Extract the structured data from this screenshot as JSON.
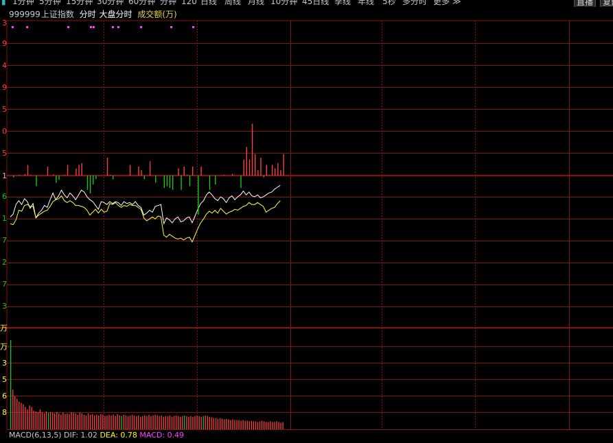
{
  "topbar": {
    "items": [
      "1分钟",
      "5分钟",
      "15分钟",
      "30分钟",
      "60分钟",
      "分钟",
      "120",
      "日线",
      "周线",
      "月线",
      "10分钟",
      "45日线",
      "季线",
      "年线",
      "5秒",
      "多分时",
      "更多 ≫"
    ],
    "buttons": [
      "直播",
      "复盘"
    ]
  },
  "info": {
    "code": "999999",
    "name": "上证指数",
    "mode": "分时",
    "view": "大盘分时",
    "indicator": "成交额(万)"
  },
  "macd": {
    "label": "MACD(6,13,5)",
    "dif": "DIF: 1.02",
    "dea": "DEA: 0.78",
    "macd": "MACD: 0.49"
  },
  "upper_axis_labels": [
    "3",
    "9",
    "4",
    "9",
    "5",
    "0",
    "5",
    "1",
    "6",
    "1",
    "7",
    "2",
    "7",
    "3",
    "万"
  ],
  "lower_axis_labels": [
    "万",
    "3",
    "5",
    "6",
    "8"
  ],
  "colors": {
    "background": "#000000",
    "grid": "#8a1111",
    "up": "#ff4040",
    "down": "#14c814",
    "price_line": "#ffffff",
    "avg_line": "#ffff40",
    "dif": "#ffff00",
    "macd": "#ff40ff",
    "marker": "#ff40ff"
  },
  "chart_data": [
    {
      "type": "line",
      "series": [
        {
          "values": [
            -0.55,
            -0.4,
            0.1,
            0.3,
            0.1,
            0.4,
            0.25,
            -0.1,
            0.15,
            -0.6,
            -0.35,
            -0.2,
            0.05,
            -0.05,
            0.35,
            0.7,
            0.35,
            0.55,
            0.85,
            0.6,
            0.45,
            0.7,
            0.55,
            0.35,
            0.6,
            0.85,
            0.75,
            0.5,
            0.35,
            0.25,
            0.05,
            -0.15,
            0.25,
            0.2,
            0.1,
            0.25,
            0.15,
            0.25,
            0.2,
            0.05,
            0.25,
            0.15,
            0.2,
            0.1,
            0.25,
            0.05,
            -0.05,
            -0.45,
            -0.35,
            -0.2,
            -0.3,
            0.0,
            0.05,
            0.1,
            -0.9,
            -0.6,
            -0.7,
            -0.85,
            -0.65,
            -0.55,
            -0.8,
            -0.75,
            -0.6,
            -0.55,
            -0.85,
            -0.5,
            -0.15,
            0.15,
            0.3,
            0.6,
            0.75,
            0.6,
            0.4,
            0.3,
            0.5,
            0.4,
            0.2,
            0.45,
            0.55,
            0.35,
            0.5,
            0.6,
            0.8,
            0.6,
            0.75,
            0.55,
            0.5,
            0.6,
            0.45,
            0.5,
            0.6,
            0.7,
            0.75,
            0.9,
            1.0,
            1.1
          ]
        },
        {
          "values": [
            -0.9,
            -0.95,
            -0.7,
            -0.2,
            -0.25,
            0.05,
            0.1,
            0.0,
            0.0,
            -0.6,
            -0.45,
            -0.35,
            -0.25,
            -0.2,
            0.0,
            0.25,
            0.35,
            0.4,
            0.55,
            0.3,
            0.2,
            0.3,
            0.2,
            0.05,
            0.05,
            0.0,
            -0.05,
            -0.2,
            -0.45,
            -0.3,
            -0.15,
            -0.35,
            -0.15,
            -0.3,
            -0.25,
            0.15,
            0.1,
            0.2,
            0.05,
            -0.05,
            0.05,
            0.0,
            0.1,
            0.05,
            0.05,
            -0.05,
            -0.15,
            -0.6,
            -0.75,
            -0.65,
            -0.55,
            -0.65,
            -0.5,
            -0.55,
            -1.5,
            -1.6,
            -1.45,
            -1.55,
            -1.65,
            -1.7,
            -1.65,
            -1.75,
            -1.65,
            -1.6,
            -1.85,
            -1.5,
            -1.15,
            -0.85,
            -0.65,
            -0.4,
            -0.25,
            -0.35,
            -0.2,
            -0.35,
            -0.1,
            -0.25,
            -0.4,
            -0.3,
            -0.25,
            -0.15,
            -0.2,
            -0.1,
            0.0,
            0.05,
            0.2,
            0.1,
            0.1,
            0.2,
            0.1,
            0.0,
            -0.3,
            -0.2,
            -0.1,
            -0.05,
            0.15,
            0.3
          ]
        }
      ]
    },
    {
      "type": "bar",
      "values": [
        0,
        -0.05,
        0,
        0.02,
        0,
        0.04,
        0.3,
        0.02,
        0,
        -0.3,
        0,
        0,
        0,
        0.25,
        0,
        0.03,
        -0.2,
        -0.12,
        0,
        0.02,
        0.3,
        0,
        0,
        0.2,
        0.3,
        0.35,
        0,
        -0.4,
        -0.5,
        -0.25,
        -0.1,
        0,
        0,
        0,
        0.5,
        0.02,
        -0.1,
        0,
        0,
        0,
        0,
        0,
        0.3,
        0,
        0,
        0.25,
        0.15,
        -0.1,
        0,
        0.4,
        0,
        -0.2,
        0,
        0,
        -0.35,
        -0.3,
        -0.35,
        -0.4,
        0,
        0.2,
        -0.4,
        0.25,
        0.02,
        -0.3,
        0.25,
        0,
        -1.1,
        0.25,
        0,
        0,
        -0.4,
        0,
        -0.25,
        0,
        0,
        0.02,
        0,
        0,
        0.05,
        0,
        0,
        -0.35,
        0.45,
        0.8,
        0.45,
        1.45,
        0.6,
        0.15,
        0.5,
        -0.05,
        0.3,
        0.02,
        0.3,
        0.2,
        0.35,
        0.15,
        0.6
      ],
      "ylim": [
        -2,
        2
      ]
    },
    {
      "type": "bar",
      "values": [
        135,
        60,
        50,
        46,
        42,
        40,
        38,
        34,
        30,
        36,
        34,
        28,
        27,
        26,
        30,
        26,
        24,
        27,
        25,
        26,
        25,
        24,
        26,
        24,
        22,
        25,
        23,
        24,
        23,
        26,
        25,
        24,
        22,
        25,
        24,
        22,
        21,
        24,
        22,
        23,
        21,
        22,
        21,
        23,
        22,
        20,
        21,
        22,
        21,
        22,
        20,
        23,
        21,
        20,
        22,
        21,
        20,
        21,
        22,
        21,
        20,
        21,
        19,
        20,
        21,
        20,
        22,
        20,
        21,
        22,
        21,
        20,
        21,
        19,
        20,
        20,
        21,
        19,
        20,
        21,
        20,
        19,
        20,
        21,
        20,
        19,
        20,
        19,
        20,
        21,
        20,
        19,
        20,
        21,
        20,
        19,
        18,
        17,
        17,
        16,
        17,
        16,
        15,
        16,
        15,
        14,
        15,
        14,
        14,
        14,
        13,
        14,
        13,
        13,
        12,
        13,
        12,
        12,
        11,
        12,
        13,
        12,
        11,
        11,
        12,
        11,
        11,
        12,
        11,
        10,
        11
      ],
      "ylim": [
        0,
        140
      ]
    }
  ]
}
